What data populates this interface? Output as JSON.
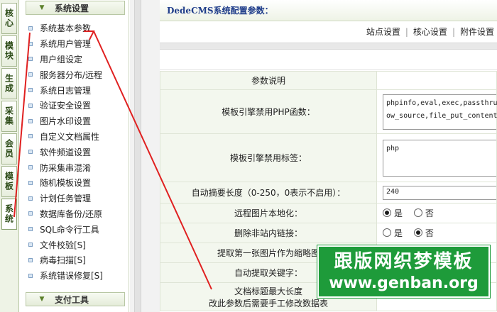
{
  "vtabs": [
    "核心",
    "模块",
    "生成",
    "采集",
    "会员",
    "模板",
    "系统"
  ],
  "sidebar": {
    "section1": "系统设置",
    "items": [
      "系统基本参数",
      "系统用户管理",
      "用户组设定",
      "服务器分布/远程",
      "系统日志管理",
      "验证安全设置",
      "图片水印设置",
      "自定义文档属性",
      "软件频道设置",
      "防采集串混淆",
      "随机模板设置",
      "计划任务管理",
      "数据库备份/还原",
      "SQL命令行工具",
      "文件校验[S]",
      "病毒扫描[S]",
      "系统错误修复[S]"
    ],
    "section2": "支付工具"
  },
  "main": {
    "title": "DedeCMS系统配置参数：",
    "tabs": [
      "站点设置",
      "核心设置",
      "附件设置"
    ],
    "table_header": "参数说明",
    "rows": [
      {
        "label": "模板引擎禁用PHP函数：",
        "value": "phpinfo,eval,exec,passthru,\now_source,file_put_contents"
      },
      {
        "label": "模板引擎禁用标签：",
        "value": "php"
      },
      {
        "label": "自动摘要长度（0-250，0表示不启用）：",
        "value": "240"
      },
      {
        "label": "远程图片本地化：",
        "opt_yes": "是",
        "opt_no": "否"
      },
      {
        "label": "删除非站内链接：",
        "opt_yes": "是",
        "opt_no": "否"
      },
      {
        "label": "提取第一张图片作为缩略图"
      },
      {
        "label": "自动提取关键字："
      },
      {
        "label": "文档标题最大长度",
        "label2": "改此参数后需要手工修改数据表"
      }
    ]
  },
  "watermark": {
    "line1": "跟版网织梦模板",
    "line2": "www.genban.org"
  },
  "colors": {
    "accent_green": "#1e9b3a",
    "annotation_red": "#e02020",
    "title_blue": "#1f3d8a"
  }
}
